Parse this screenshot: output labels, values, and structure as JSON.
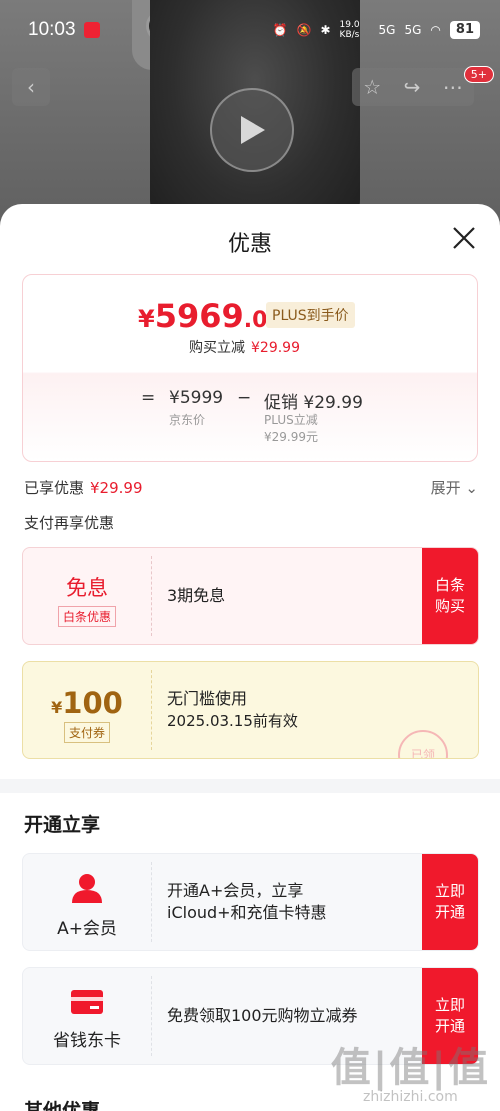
{
  "status_bar": {
    "time": "10:03",
    "net_speed": "19.0 KB/s",
    "signal1": "5G",
    "signal2": "5G",
    "battery": "81"
  },
  "header": {
    "cart_badge": "5+"
  },
  "sheet": {
    "title": "优惠"
  },
  "price_card": {
    "currency": "¥",
    "final_int": "5969",
    "final_dec": ".01",
    "plus_tag": "PLUS到手价",
    "buy_reduce_label": "购买立减",
    "buy_reduce_amount": "¥29.99",
    "eq": "=",
    "jd_price": "¥5999",
    "jd_price_label": "京东价",
    "minus": "−",
    "promo": "促销 ¥29.99",
    "promo_sub1": "PLUS立减",
    "promo_sub2": "¥29.99元"
  },
  "enjoyed": {
    "label": "已享优惠",
    "amount": "¥29.99",
    "expand": "展开"
  },
  "pay_more_title": "支付再享优惠",
  "coupons": [
    {
      "big": "免息",
      "tag": "白条优惠",
      "desc": "3期免息",
      "action": "白条购买"
    },
    {
      "currency": "¥",
      "value": "100",
      "tag": "支付券",
      "desc1": "无门槛使用",
      "desc2": "2025.03.15前有效",
      "stamp": "已领"
    }
  ],
  "open_section_title": "开通立享",
  "members": [
    {
      "label": "A+会员",
      "desc1": "开通A+会员，立享",
      "desc2": "iCloud+和充值卡特惠",
      "action": "立即开通"
    },
    {
      "label": "省钱东卡",
      "desc1": "免费领取100元购物立减券",
      "action": "立即开通"
    }
  ],
  "other_section_title": "其他优惠",
  "watermark": {
    "big": "值|值|值",
    "small": "zhizhizhi.com"
  },
  "colors": {
    "accent": "#f0192c",
    "price_red": "#e81d2e",
    "gold": "#a06411"
  }
}
